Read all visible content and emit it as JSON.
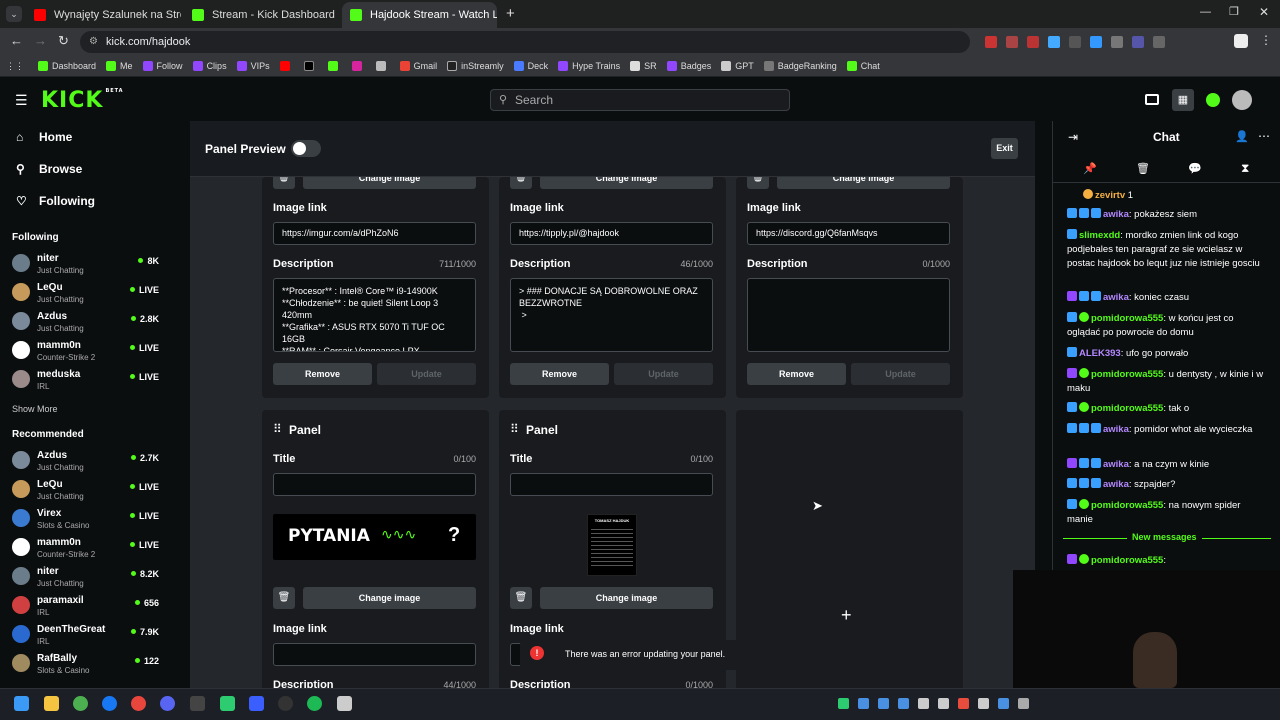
{
  "browser": {
    "tabs": [
      {
        "title": "Wynajęty Szalunek na Strop - U",
        "color": "#ff0000"
      },
      {
        "title": "Stream - Kick Dashboard",
        "color": "#53fc18"
      },
      {
        "title": "Hajdook Stream - Watch Live o",
        "color": "#53fc18"
      }
    ],
    "new_tab": "+",
    "url": "kick.com/hajdook",
    "bookmarks": [
      "Dashboard",
      "Me",
      "Follow",
      "Clips",
      "VIPs",
      "",
      "",
      "",
      "",
      "Gmail",
      "inStreamly",
      "Deck",
      "Hype Trains",
      "SR",
      "Badges",
      "GPT",
      "BadgeRanking",
      "Chat"
    ]
  },
  "kick": {
    "logo": "KICK",
    "logo_badge": "BETA",
    "search_placeholder": "Search"
  },
  "sidebar": {
    "nav": [
      {
        "label": "Home",
        "icon": "⌂"
      },
      {
        "label": "Browse",
        "icon": "⚲"
      },
      {
        "label": "Following",
        "icon": "♡"
      }
    ],
    "following_title": "Following",
    "following": [
      {
        "name": "niter",
        "category": "Just Chatting",
        "viewers": "8K",
        "color": "#6b7c8a"
      },
      {
        "name": "LeQu",
        "category": "Just Chatting",
        "viewers": "LIVE",
        "color": "#c59a5a"
      },
      {
        "name": "Azdus",
        "category": "Just Chatting",
        "viewers": "2.8K",
        "color": "#7a8a9a"
      },
      {
        "name": "mamm0n",
        "category": "Counter-Strike 2",
        "viewers": "LIVE",
        "color": "#ffffff"
      },
      {
        "name": "meduska",
        "category": "IRL",
        "viewers": "LIVE",
        "color": "#9a8a8a"
      }
    ],
    "show_more": "Show More",
    "recommended_title": "Recommended",
    "recommended": [
      {
        "name": "Azdus",
        "category": "Just Chatting",
        "viewers": "2.7K",
        "color": "#7a8a9a"
      },
      {
        "name": "LeQu",
        "category": "Just Chatting",
        "viewers": "LIVE",
        "color": "#c59a5a"
      },
      {
        "name": "Virex",
        "category": "Slots & Casino",
        "viewers": "LIVE",
        "color": "#3a7ad0"
      },
      {
        "name": "mamm0n",
        "category": "Counter-Strike 2",
        "viewers": "LIVE",
        "color": "#ffffff"
      },
      {
        "name": "niter",
        "category": "Just Chatting",
        "viewers": "8.2K",
        "color": "#6b7c8a"
      },
      {
        "name": "paramaxil",
        "category": "IRL",
        "viewers": "656",
        "color": "#d04040"
      },
      {
        "name": "DeenTheGreat",
        "category": "IRL",
        "viewers": "7.9K",
        "color": "#2a6ad0"
      },
      {
        "name": "RafBally",
        "category": "Slots & Casino",
        "viewers": "122",
        "color": "#a08a60"
      }
    ]
  },
  "panel_editor": {
    "preview_label": "Panel Preview",
    "exit_label": "Exit",
    "change_image": "Change image",
    "image_link_label": "Image link",
    "description_label": "Description",
    "title_label": "Title",
    "remove_label": "Remove",
    "update_label": "Update",
    "panel_label": "Panel",
    "top_cards": [
      {
        "link": "https://imgur.com/a/dPhZoN6",
        "desc_count": "711/1000",
        "description": "**Procesor** : Intel® Core™ i9-14900K\n**Chłodzenie** : be quiet! Silent Loop 3 420mm\n**Grafika** : ASUS RTX 5070 Ti TUF OC 16GB\n**RAM** : Corsair Vengeance LPX"
      },
      {
        "link": "https://tipply.pl/@hajdook",
        "desc_count": "46/1000",
        "description": "> ### DONACJE SĄ DOBROWOLNE ORAZ BEZZWROTNE\n >"
      },
      {
        "link": "https://discord.gg/Q6fanMsqvs",
        "desc_count": "0/1000",
        "description": ""
      }
    ],
    "bottom_cards": [
      {
        "title_count": "0/100",
        "image_text": "PYTANIA",
        "image_q": "?",
        "desc_count": "44/1000"
      },
      {
        "title_count": "0/100",
        "image_text": "TOMASZ HAJDUK",
        "desc_count": "0/1000"
      }
    ],
    "add_panel": "+",
    "toast": "There was an error updating your panel."
  },
  "chat": {
    "title": "Chat",
    "new_messages": "New messages",
    "messages": [
      {
        "user": "zevirtv",
        "text": " 1",
        "color": "#f5b041"
      },
      {
        "user": "awika",
        "text": ": pokażesz siem",
        "color": "#b388ff"
      },
      {
        "user": "slimexdd",
        "text": ": mordko zmien link od kogo podjebales ten paragraf ze sie wcielasz w postac hajdook bo lequt juz nie istnieje gosciu",
        "color": "#53fc18"
      },
      {
        "user": "awika",
        "text": ": koniec czasu",
        "color": "#b388ff"
      },
      {
        "user": "pomidorowa555",
        "text": ": w końcu jest co oglądać po powrocie do domu",
        "color": "#53fc18"
      },
      {
        "user": "ALEK393",
        "text": ": ufo go porwało",
        "color": "#b388ff"
      },
      {
        "user": "pomidorowa555",
        "text": ": u dentysty , w kinie i w maku",
        "color": "#53fc18"
      },
      {
        "user": "pomidorowa555",
        "text": ": tak o",
        "color": "#53fc18"
      },
      {
        "user": "awika",
        "text": ": pomidor whot ale wycieczka",
        "color": "#b388ff"
      },
      {
        "user": "awika",
        "text": ": a na czym w kinie",
        "color": "#b388ff"
      },
      {
        "user": "awika",
        "text": ": szpajder?",
        "color": "#b388ff"
      },
      {
        "user": "pomidorowa555",
        "text": ": na nowym spider manie",
        "color": "#53fc18"
      },
      {
        "user": "pomidorowa555",
        "text": ":",
        "color": "#53fc18"
      }
    ]
  }
}
